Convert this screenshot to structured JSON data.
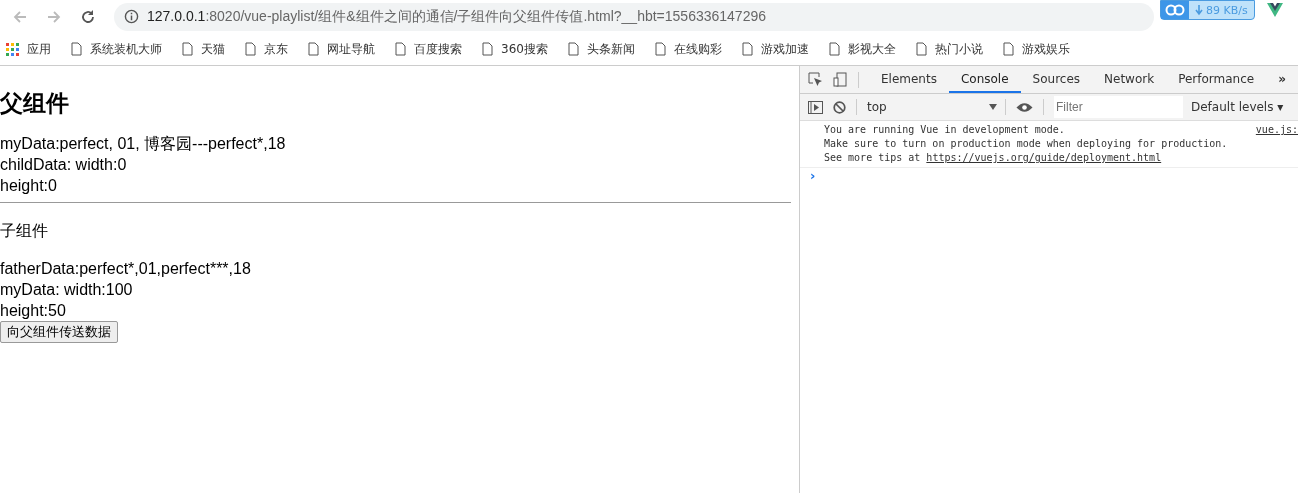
{
  "browser": {
    "url_host": "127.0.0.1",
    "url_rest": ":8020/vue-playlist/组件&组件之间的通信/子组件向父组件传值.html?__hbt=1556336147296",
    "speed_badge": "89 KB/s",
    "bookmarks": [
      {
        "label": "应用",
        "kind": "apps"
      },
      {
        "label": "系统装机大师",
        "kind": "page"
      },
      {
        "label": "天猫",
        "kind": "page"
      },
      {
        "label": "京东",
        "kind": "page"
      },
      {
        "label": "网址导航",
        "kind": "page"
      },
      {
        "label": "百度搜索",
        "kind": "page"
      },
      {
        "label": "360搜索",
        "kind": "page"
      },
      {
        "label": "头条新闻",
        "kind": "page"
      },
      {
        "label": "在线购彩",
        "kind": "page"
      },
      {
        "label": "游戏加速",
        "kind": "page"
      },
      {
        "label": "影视大全",
        "kind": "page"
      },
      {
        "label": "热门小说",
        "kind": "page"
      },
      {
        "label": "游戏娱乐",
        "kind": "page"
      }
    ]
  },
  "page": {
    "heading": "父组件",
    "parent_lines": [
      "myData:perfect, 01, 博客园---perfect*,18",
      "childData: width:0",
      "height:0"
    ],
    "child_title": "子组件",
    "child_lines": [
      "fatherData:perfect*,01,perfect***,18",
      "myData: width:100",
      "height:50"
    ],
    "button": "向父组件传送数据"
  },
  "devtools": {
    "tabs": [
      {
        "label": "Elements",
        "selected": false
      },
      {
        "label": "Console",
        "selected": true
      },
      {
        "label": "Sources",
        "selected": false
      },
      {
        "label": "Network",
        "selected": false
      },
      {
        "label": "Performance",
        "selected": false
      }
    ],
    "more": "»",
    "context": "top",
    "filter": {
      "placeholder": "Filter"
    },
    "levels": "Default levels ▾",
    "messages": [
      {
        "lines": [
          "You are running Vue in development mode.",
          "Make sure to turn on production mode when deploying for production."
        ],
        "tip_prefix": "See more tips at ",
        "link": "https://vuejs.org/guide/deployment.html",
        "source": "vue.js:"
      }
    ],
    "prompt": "›"
  }
}
